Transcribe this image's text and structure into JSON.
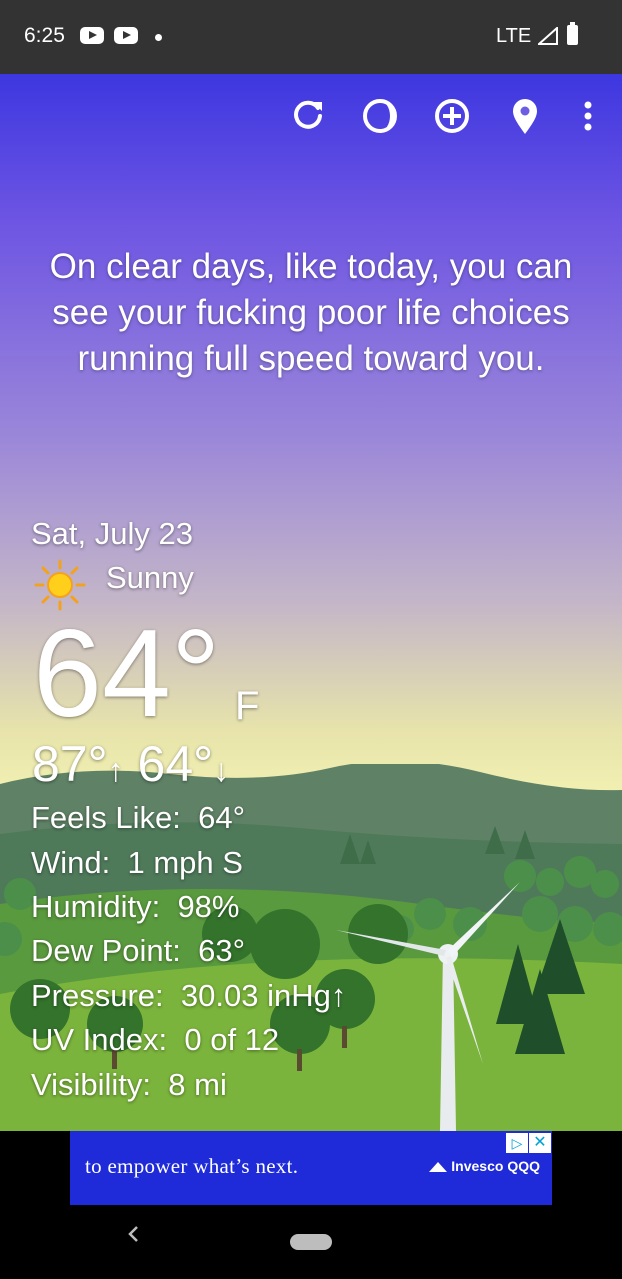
{
  "status": {
    "time": "6:25",
    "network": "LTE"
  },
  "toolbar": {
    "refresh_icon": "refresh-icon",
    "theme_icon": "moon-theme-icon",
    "add_icon": "add-location-icon",
    "location_icon": "map-pin-icon",
    "menu_icon": "more-vert-icon"
  },
  "quote": "On clear days, like today, you can see your fucking poor life choices running full speed toward you.",
  "weather": {
    "date": "Sat, July 23",
    "condition": "Sunny",
    "condition_icon": "sun-icon",
    "temperature": "64°",
    "unit": "F",
    "high": "87°",
    "high_arrow": "↑",
    "low": "64°",
    "low_arrow": "↓",
    "details": [
      {
        "label": "Feels Like:",
        "value": "64°"
      },
      {
        "label": "Wind:",
        "value": "1 mph S"
      },
      {
        "label": "Humidity:",
        "value": "98%"
      },
      {
        "label": "Dew Point:",
        "value": "63°"
      },
      {
        "label": "Pressure:",
        "value": "30.03 inHg↑"
      },
      {
        "label": "UV Index:",
        "value": "0 of 12"
      },
      {
        "label": "Visibility:",
        "value": "8 mi"
      }
    ]
  },
  "ad": {
    "text": "to empower what’s next.",
    "brand": "Invesco QQQ",
    "choices": "▷",
    "close": "✕"
  },
  "colors": {
    "sky_top": "#3d37e0",
    "sky_bottom": "#f8f9b6",
    "status_bar": "#333333",
    "ad_blue": "#1f2bd8"
  }
}
